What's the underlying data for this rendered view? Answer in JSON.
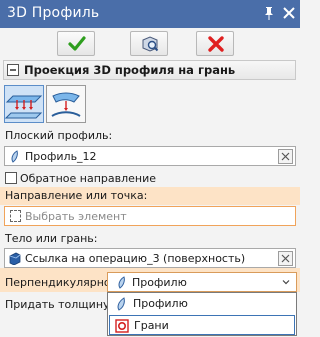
{
  "window": {
    "title": "3D Профиль"
  },
  "icons": {
    "pin": "pin-icon",
    "close": "close-icon",
    "ok": "checkmark-icon",
    "preview": "preview-icon",
    "cancel": "cancel-icon",
    "profile": "profile-sketch-icon",
    "face": "face-icon"
  },
  "colors": {
    "titlebar": "#4a6ea9",
    "ok": "#2e9e1e",
    "cancel": "#e02020",
    "highlight": "#fde3c6",
    "active_mode": "#cfe2f6"
  },
  "section": {
    "title": "Проекция 3D профиля на грань",
    "collapse_symbol": "⊟"
  },
  "fields": {
    "flat_profile": {
      "label": "Плоский профиль:",
      "value": "Профиль_12"
    },
    "reverse_direction": {
      "label": "Обратное направление",
      "checked": false
    },
    "direction_or_point": {
      "label": "Направление или точка:",
      "placeholder": "Выбрать элемент"
    },
    "body_or_face": {
      "label": "Тело или грань:",
      "value": "Ссылка на операцию_3 (поверхность)"
    },
    "perpendicular": {
      "label": "Перпендикулярно:",
      "value": "Профилю"
    },
    "give_thickness": {
      "label": "Придать толщину:"
    }
  },
  "dropdown": {
    "options": [
      {
        "label": "Профилю",
        "icon": "profile-sketch-icon"
      },
      {
        "label": "Грани",
        "icon": "face-icon",
        "selected": true
      }
    ]
  }
}
